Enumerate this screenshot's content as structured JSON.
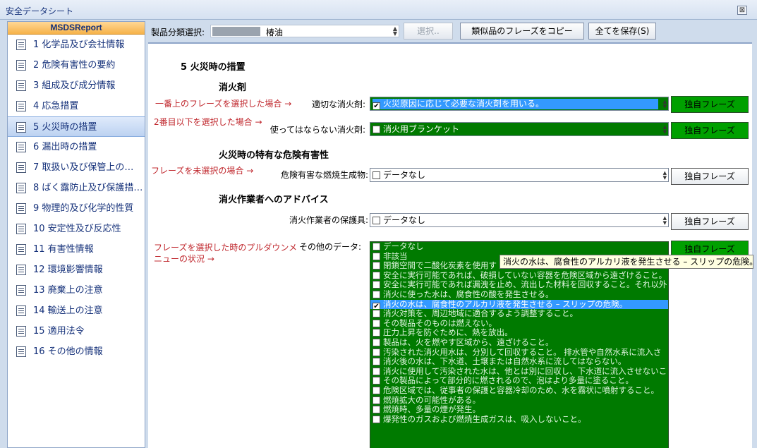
{
  "window": {
    "title": "安全データシート",
    "close_glyph": "⊠"
  },
  "sidebar": {
    "header": "MSDSReport",
    "items": [
      {
        "label": "1 化学品及び会社情報"
      },
      {
        "label": "2 危険有害性の要約"
      },
      {
        "label": "3 組成及び成分情報"
      },
      {
        "label": "4 応急措置"
      },
      {
        "label": "5 火災時の措置",
        "active": true
      },
      {
        "label": "6 漏出時の措置"
      },
      {
        "label": "7 取扱い及び保管上の…"
      },
      {
        "label": "8 ばく露防止及び保護措…"
      },
      {
        "label": "9 物理的及び化学的性質"
      },
      {
        "label": "10 安定性及び反応性"
      },
      {
        "label": "11 有害性情報"
      },
      {
        "label": "12 環境影響情報"
      },
      {
        "label": "13 廃棄上の注意"
      },
      {
        "label": "14 輸送上の注意"
      },
      {
        "label": "15 適用法令"
      },
      {
        "label": "16 その他の情報"
      }
    ]
  },
  "toolbar": {
    "category_label": "製品分類選択:",
    "category_value": "椿油",
    "select_button": "選択..",
    "copy_button": "類似品のフレーズをコピー",
    "save_button": "全てを保存(S)"
  },
  "section": {
    "title": "5 火災時の措置",
    "extinguish_heading": "消火剤",
    "hazard_heading": "火災時の特有な危険有害性",
    "advice_heading": "消火作業者へのアドバイス"
  },
  "notes": {
    "first": "一番上のフレーズを選択した場合 →",
    "second": "2番目以下を選択した場合 →",
    "unselected": "フレーズを未選択の場合 →",
    "dropdown_line1": "フレーズを選択した時のプルダウンメ",
    "dropdown_line2": "ニューの状況 →"
  },
  "fields": {
    "suitable": {
      "label": "適切な消火剤:",
      "value": "火災原因に応じて必要な消火剤を用いる。",
      "checked": true
    },
    "unsuitable": {
      "label": "使ってはならない消火剤:",
      "value": "消火用ブランケット",
      "checked": false
    },
    "combustion": {
      "label": "危険有害な燃焼生成物:",
      "value": "データなし",
      "checked": false
    },
    "protective": {
      "label": "消火作業者の保護具:",
      "value": "データなし",
      "checked": false
    },
    "other": {
      "label": "その他のデータ:"
    }
  },
  "own_phrase_button": "独自フレーズ",
  "dropdown": {
    "items": [
      {
        "text": "データなし",
        "checked": false
      },
      {
        "text": "非該当",
        "checked": false
      },
      {
        "text": "閉鎖空間で二酸化炭素を使用す",
        "checked": false
      },
      {
        "text": "安全に実行可能であれば、破損していない容器を危険区域から遠ざけること。",
        "checked": false
      },
      {
        "text": "安全に実行可能であれば漏洩を止め、流出した材料を回収すること。それ以外",
        "checked": false
      },
      {
        "text": "消火に使った水は、腐食性の酸を発生させる。",
        "checked": false
      },
      {
        "text": "消火の水は、腐食性のアルカリ液を発生させる – スリップの危険。",
        "checked": true,
        "selected": true
      },
      {
        "text": "消火対策を、周辺地域に適合するよう調整すること。",
        "checked": false
      },
      {
        "text": "その製品そのものは燃えない。",
        "checked": false
      },
      {
        "text": "圧力上昇を防ぐために、熱を放出。",
        "checked": false
      },
      {
        "text": "製品は、火を燃やす区域から、遠ざけること。",
        "checked": false
      },
      {
        "text": "汚染された消火用水は、分別して回収すること。 排水管や自然水系に流入さ",
        "checked": false
      },
      {
        "text": "消火後の水は、下水道、土壌または自然水系に流してはならない。",
        "checked": false
      },
      {
        "text": "消火に使用して汚染された水は、他とは別に回収し、下水道に流入させないこと",
        "checked": false
      },
      {
        "text": "その製品によって部分的に燃されるので、泡はより多量に塗ること。",
        "checked": false
      },
      {
        "text": "危険区域では、従事者の保護と容器冷却のため、水を霧状に噴射すること。",
        "checked": false
      },
      {
        "text": "燃焼拡大の可能性がある。",
        "checked": false
      },
      {
        "text": "燃焼時、多量の煙が発生。",
        "checked": false
      },
      {
        "text": "爆発性のガスおよび燃焼生成ガスは、吸入しないこと。",
        "checked": false
      }
    ]
  },
  "tooltip": "消火の水は、腐食性のアルカリ液を発生させる – スリップの危険。"
}
